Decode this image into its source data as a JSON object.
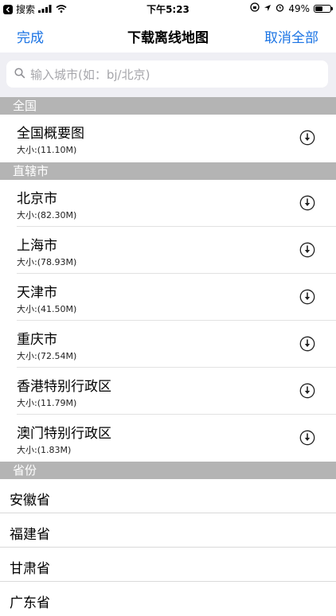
{
  "status_bar": {
    "back_app": "搜索",
    "time": "下午5:23",
    "battery": "49%",
    "battery_level": 0.49
  },
  "nav": {
    "left": "完成",
    "title": "下载离线地图",
    "right": "取消全部"
  },
  "search": {
    "placeholder": "输入城市(如：bj/北京)"
  },
  "sections": {
    "national": "全国",
    "municipality": "直辖市",
    "province": "省份"
  },
  "national_items": [
    {
      "name": "全国概要图",
      "size": "大小:(11.10M)"
    }
  ],
  "municipality_items": [
    {
      "name": "北京市",
      "size": "大小:(82.30M)"
    },
    {
      "name": "上海市",
      "size": "大小:(78.93M)"
    },
    {
      "name": "天津市",
      "size": "大小:(41.50M)"
    },
    {
      "name": "重庆市",
      "size": "大小:(72.54M)"
    },
    {
      "name": "香港特别行政区",
      "size": "大小:(11.79M)"
    },
    {
      "name": "澳门特别行政区",
      "size": "大小:(1.83M)"
    }
  ],
  "province_items": [
    {
      "name": "安徽省"
    },
    {
      "name": "福建省"
    },
    {
      "name": "甘肃省"
    },
    {
      "name": "广东省"
    }
  ],
  "colors": {
    "accent": "#1b74e4",
    "section_header": "#b4b4b4",
    "search_bg": "#efeff4"
  },
  "icons": {
    "download": "download-circle-icon",
    "search": "search-icon"
  }
}
